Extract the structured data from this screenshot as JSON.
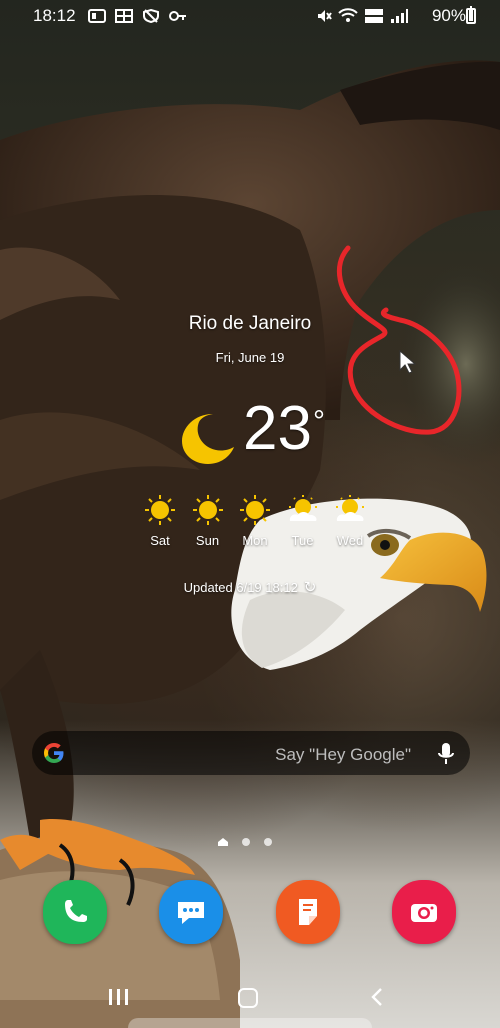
{
  "status_bar": {
    "time": "18:12",
    "battery": "90%",
    "battery_level": 0.9
  },
  "weather": {
    "city": "Rio de Janeiro",
    "date": "Fri, June 19",
    "temperature": "23",
    "degree_symbol": "°",
    "forecast": [
      {
        "label": "Sat",
        "icon": "sun-icon"
      },
      {
        "label": "Sun",
        "icon": "sun-icon"
      },
      {
        "label": "Mon",
        "icon": "sun-icon"
      },
      {
        "label": "Tue",
        "icon": "partly-cloudy-icon"
      },
      {
        "label": "Wed",
        "icon": "partly-cloudy-icon"
      }
    ],
    "updated": "Updated 6/19 18:12"
  },
  "search": {
    "hint": "Say \"Hey Google\""
  },
  "dock": {
    "apps": [
      {
        "name": "phone",
        "color": "#1fb65a"
      },
      {
        "name": "messages",
        "color": "#1a8fe8"
      },
      {
        "name": "notes",
        "color": "#f05a22"
      },
      {
        "name": "camera",
        "color": "#e91e4a"
      }
    ]
  },
  "colors": {
    "annotation": "#e8262a",
    "moon": "#f6c400",
    "sun": "#f6c400"
  }
}
